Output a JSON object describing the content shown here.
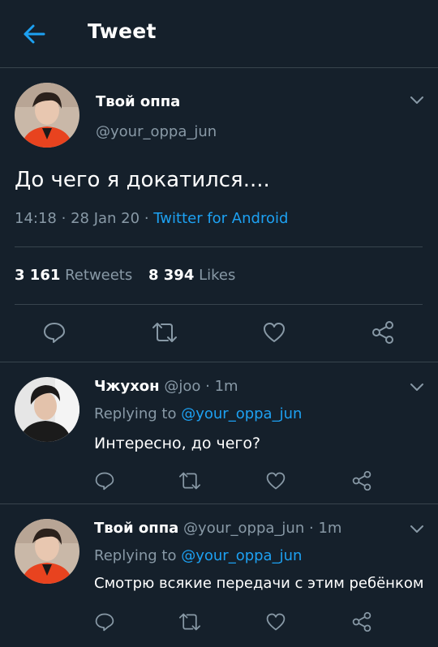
{
  "header": {
    "title": "Tweet"
  },
  "main_tweet": {
    "author_name": "Твой оппа",
    "author_handle": "@your_oppa_jun",
    "text": "До чего я докатился....",
    "time": "14:18",
    "date": "28 Jan 20",
    "source": "Twitter for Android",
    "retweets_count": "3 161",
    "retweets_label": "Retweets",
    "likes_count": "8 394",
    "likes_label": "Likes"
  },
  "replies": [
    {
      "author_name": "Чжухон",
      "author_handle": "@joo",
      "time": "1m",
      "replying_label": "Replying to",
      "replying_to": "@your_oppa_jun",
      "text": "Интересно, до чего?"
    },
    {
      "author_name": "Твой оппа",
      "author_handle": "@your_oppa_jun",
      "time": "1m",
      "replying_label": "Replying to",
      "replying_to": "@your_oppa_jun",
      "text": "Смотрю всякие передачи с этим ребёнком"
    }
  ],
  "separator": "·",
  "icons": [
    "back-arrow-icon",
    "chevron-down-icon",
    "reply-icon",
    "retweet-icon",
    "like-icon",
    "share-icon"
  ],
  "colors": {
    "background": "#15202b",
    "accent": "#1da1f2",
    "muted": "#8899a6",
    "divider": "#38444d"
  }
}
